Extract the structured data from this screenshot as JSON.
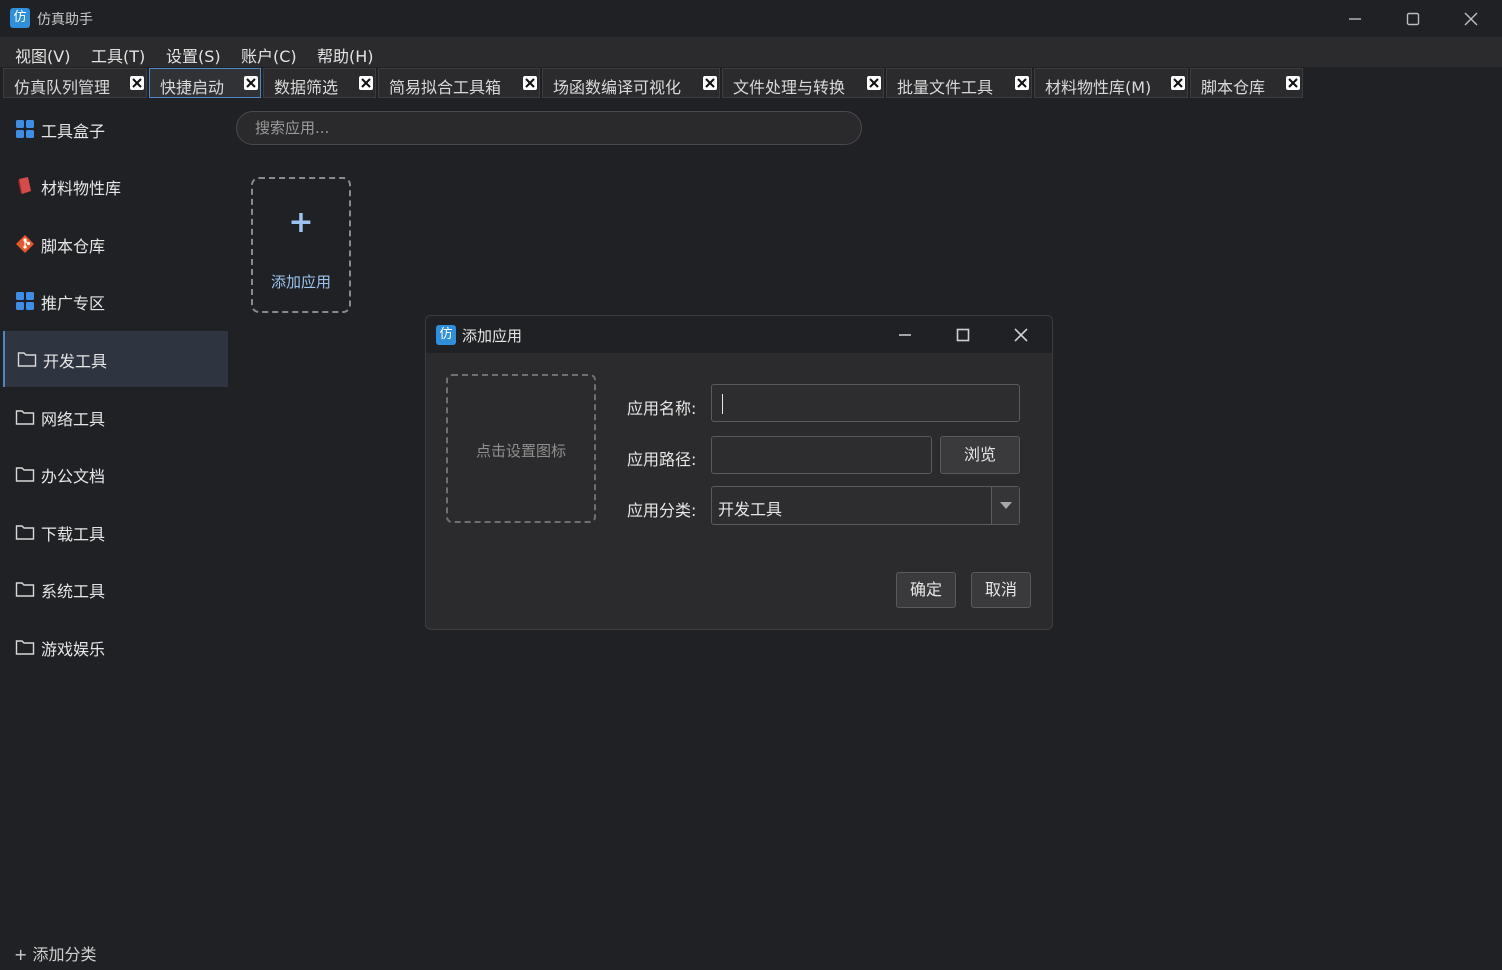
{
  "window": {
    "logo_glyph": "仿",
    "title": "仿真助手"
  },
  "menu": [
    "视图(V)",
    "工具(T)",
    "设置(S)",
    "账户(C)",
    "帮助(H)"
  ],
  "tabs": [
    {
      "label": "仿真队列管理",
      "active": false
    },
    {
      "label": "快捷启动",
      "active": true
    },
    {
      "label": "数据筛选",
      "active": false
    },
    {
      "label": "简易拟合工具箱",
      "active": false
    },
    {
      "label": "场函数编译可视化",
      "active": false
    },
    {
      "label": "文件处理与转换",
      "active": false
    },
    {
      "label": "批量文件工具",
      "active": false
    },
    {
      "label": "材料物性库(M)",
      "active": false
    },
    {
      "label": "脚本仓库",
      "active": false
    }
  ],
  "sidebar": {
    "items": [
      {
        "label": "工具盒子",
        "icon": "grid-icon",
        "active": false
      },
      {
        "label": "材料物性库",
        "icon": "book-icon",
        "active": false
      },
      {
        "label": "脚本仓库",
        "icon": "git-icon",
        "active": false
      },
      {
        "label": "推广专区",
        "icon": "grid-icon",
        "active": false
      },
      {
        "label": "开发工具",
        "icon": "folder-icon",
        "active": true
      },
      {
        "label": "网络工具",
        "icon": "folder-icon",
        "active": false
      },
      {
        "label": "办公文档",
        "icon": "folder-icon",
        "active": false
      },
      {
        "label": "下载工具",
        "icon": "folder-icon",
        "active": false
      },
      {
        "label": "系统工具",
        "icon": "folder-icon",
        "active": false
      },
      {
        "label": "游戏娱乐",
        "icon": "folder-icon",
        "active": false
      }
    ],
    "add_category": "+ 添加分类"
  },
  "main": {
    "search_placeholder": "搜索应用...",
    "add_app_plus": "+",
    "add_app_label": "添加应用"
  },
  "dialog": {
    "logo_glyph": "仿",
    "title": "添加应用",
    "icon_picker_label": "点击设置图标",
    "name_label": "应用名称:",
    "name_value": "",
    "path_label": "应用路径:",
    "path_value": "",
    "browse_label": "浏览",
    "category_label": "应用分类:",
    "category_value": "开发工具",
    "confirm_label": "确定",
    "cancel_label": "取消"
  },
  "colors": {
    "accent": "#4f86c6",
    "logo": "#2f8fdc",
    "grid_icon": "#3d8ee6",
    "book_icon": "#d84a4a",
    "git_icon": "#e8572c"
  }
}
